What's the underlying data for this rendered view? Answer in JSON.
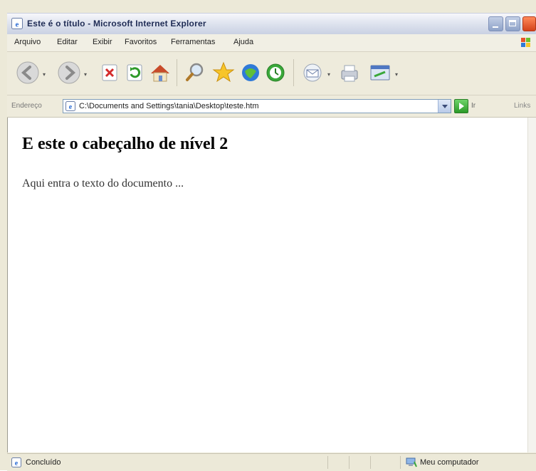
{
  "window": {
    "title": "Este é o título - Microsoft Internet Explorer"
  },
  "menu": {
    "items": [
      "Arquivo",
      "Editar",
      "Exibir",
      "Favoritos",
      "Ferramentas",
      "Ajuda"
    ]
  },
  "toolbar": {
    "icons": [
      "back-icon",
      "forward-icon",
      "stop-icon",
      "refresh-icon",
      "home-icon",
      "search-icon",
      "favorites-icon",
      "media-icon",
      "history-icon",
      "mail-icon",
      "print-icon",
      "edit-icon"
    ]
  },
  "address": {
    "label": "Endereço",
    "value": "C:\\Documents and Settings\\tania\\Desktop\\teste.htm",
    "go_label": "Ir",
    "links_label": "Links"
  },
  "page": {
    "heading": "E este o cabeçalho de nível 2",
    "paragraph": "Aqui entra o texto do documento ..."
  },
  "status": {
    "text": "Concluído",
    "zone": "Meu computador"
  },
  "colors": {
    "title_text": "#1f2c55",
    "close_button": "#d3421b",
    "go_button": "#2b9a27",
    "addr_border": "#7f9db9"
  }
}
